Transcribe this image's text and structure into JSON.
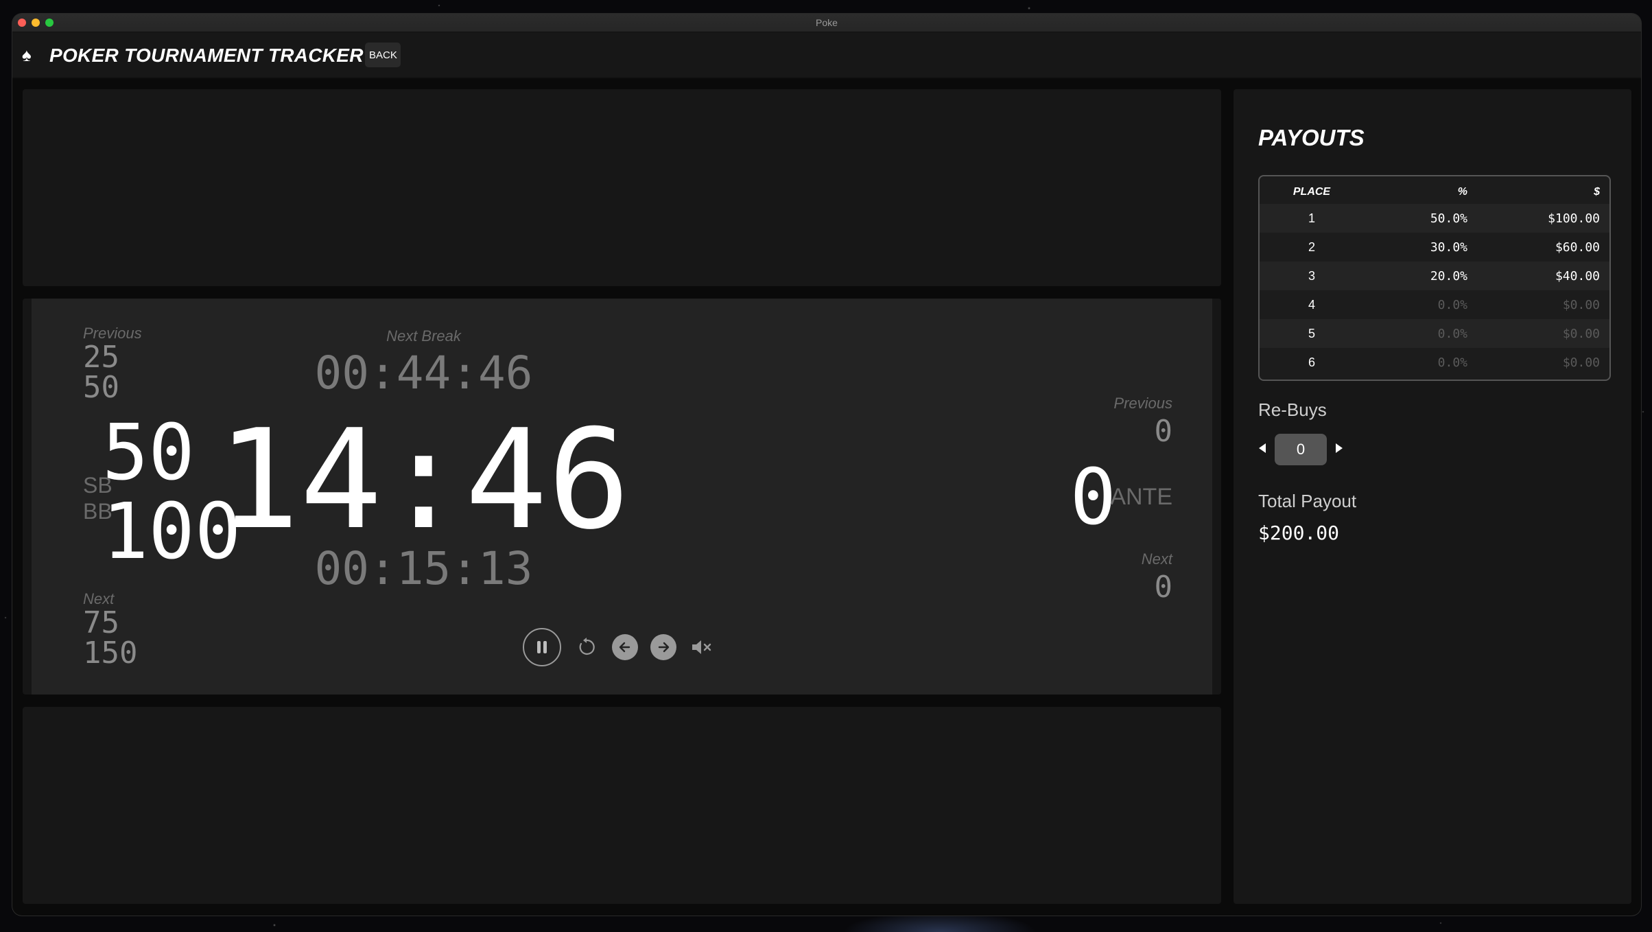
{
  "window": {
    "title": "Poke"
  },
  "header": {
    "app_title": "POKER TOURNAMENT TRACKER",
    "back_label": "BACK"
  },
  "blinds": {
    "previous_label": "Previous",
    "previous_sb": "25",
    "previous_bb": "50",
    "sb_label": "SB",
    "bb_label": "BB",
    "sb": "50",
    "bb": "100",
    "next_label": "Next",
    "next_sb": "75",
    "next_bb": "150"
  },
  "clock": {
    "next_break_label": "Next Break",
    "next_break": "00:44:46",
    "remaining": "14:46",
    "elapsed": "00:15:13"
  },
  "controls": {
    "pause": "pause-icon",
    "restart": "restart-icon",
    "previous_level": "arrow-left-icon",
    "next_level": "arrow-right-icon",
    "mute": "mute-icon"
  },
  "ante": {
    "previous_label": "Previous",
    "previous": "0",
    "value": "0",
    "label": "ANTE",
    "next_label": "Next",
    "next": "0"
  },
  "payouts": {
    "title": "PAYOUTS",
    "columns": [
      "PLACE",
      "%",
      "$"
    ],
    "rows": [
      {
        "place": "1",
        "pct": "50.0%",
        "amount": "$100.00"
      },
      {
        "place": "2",
        "pct": "30.0%",
        "amount": "$60.00"
      },
      {
        "place": "3",
        "pct": "20.0%",
        "amount": "$40.00"
      },
      {
        "place": "4",
        "pct": "0.0%",
        "amount": "$0.00"
      },
      {
        "place": "5",
        "pct": "0.0%",
        "amount": "$0.00"
      },
      {
        "place": "6",
        "pct": "0.0%",
        "amount": "$0.00"
      }
    ],
    "rebuys_label": "Re-Buys",
    "rebuys_value": "0",
    "total_label": "Total Payout",
    "total_value": "$200.00"
  },
  "colors": {
    "background": "#0a0a0a",
    "panel": "#171717",
    "clock_panel": "#232323",
    "muted": "#7a7a7a"
  }
}
